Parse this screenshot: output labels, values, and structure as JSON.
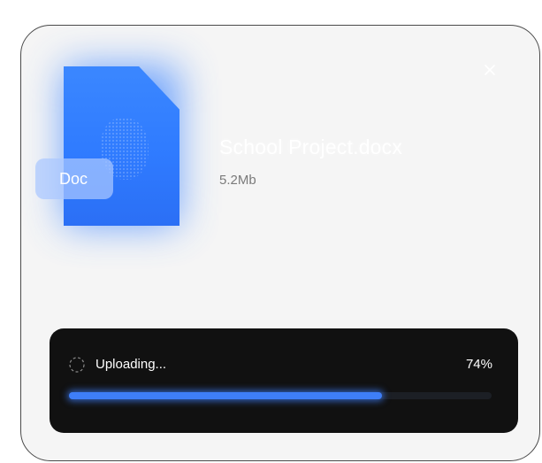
{
  "file": {
    "name": "School Project.docx",
    "size": "5.2Mb",
    "type_badge": "Doc",
    "icon": "document-icon"
  },
  "upload": {
    "status_label": "Uploading...",
    "percent_label": "74%",
    "progress": 0.74,
    "spinner_icon": "loading-spinner-icon"
  },
  "controls": {
    "close_icon": "close-icon"
  },
  "colors": {
    "accent": "#3e7ef8",
    "card_background": "#f5f5f5",
    "panel_background": "#111111"
  }
}
